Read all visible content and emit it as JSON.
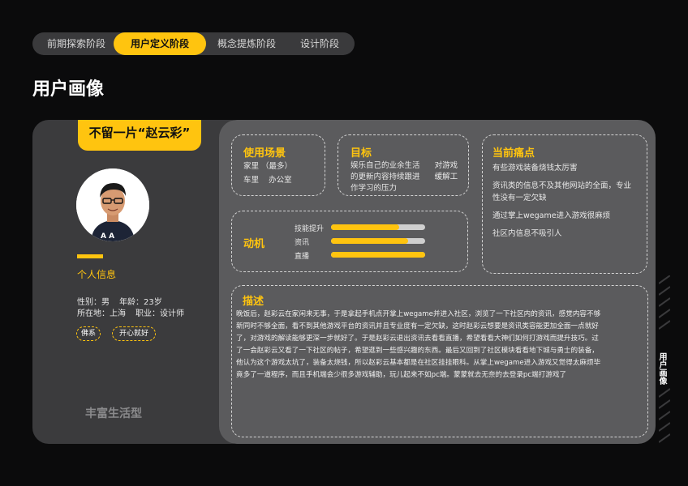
{
  "phases": [
    {
      "label": "前期探索阶段",
      "active": false
    },
    {
      "label": "用户定义阶段",
      "active": true
    },
    {
      "label": "概念提炼阶段",
      "active": false
    },
    {
      "label": "设计阶段",
      "active": false
    }
  ],
  "page_title": "用户画像",
  "persona": {
    "tagline": "不留一片“赵云彩”",
    "section_label": "个人信息",
    "gender_line": "性别：男",
    "age_line": "年龄：23岁",
    "location_line": "所在地：上海",
    "job_line": "职业：设计师",
    "tags": [
      "佛系",
      "开心就好"
    ],
    "lifestyle": "丰富生活型"
  },
  "scenario": {
    "title": "使用场景",
    "lines": [
      "家里 （最多）",
      "车里    办公室"
    ]
  },
  "goal": {
    "title": "目标",
    "lines": [
      "娱乐自己的业余生活      对游戏",
      "的更新内容持续跟进      缓解工",
      "作学习的压力"
    ]
  },
  "pain": {
    "title": "当前痛点",
    "items": [
      "有些游戏装备烧钱太厉害",
      "资讯类的信息不及其他网站的全面，专业性没有一定欠缺",
      "通过掌上wegame进入游戏很麻烦",
      "社区内信息不吸引人"
    ]
  },
  "motivation": {
    "title": "动机",
    "bars": [
      {
        "label": "技能提升",
        "value": 0.72
      },
      {
        "label": "资讯",
        "value": 0.82
      },
      {
        "label": "直播",
        "value": 1.0
      }
    ]
  },
  "description": {
    "title": "描述",
    "lines": [
      "晚饭后，赵彩云在家闲来无事，于是拿起手机点开掌上wegame并进入社区，浏览了一下社区内的资讯，感觉内容不够",
      "新同时不够全面，看不到其他游戏平台的资讯并且专业度有一定欠缺，这时赵彩云想要是资讯类容能更加全面一点就好",
      "了，对游戏的解读能够更深一步就好了。于是赵彩云退出资讯去看看直播，希望看看大神们如何打游戏而提升技巧。过",
      "了一会赵彩云又看了一下社区的帖子，希望逛到一些感兴趣的东西。最后又回到了社区模块看看地下城与勇士的装备，",
      "他认为这个游戏太坑了，装备太烧钱，所以赵彩云基本都是在社区挂挂眼科。从掌上wegame进入游戏又觉得太麻烦毕",
      "竟多了一道程序，而且手机端会少很多游戏辅助，玩儿起来不如pc端。蒙蒙就去无奈的去登录pc端打游戏了"
    ]
  },
  "side_tab": "用户画像",
  "colors": {
    "accent": "#ffc40f",
    "background": "#0b0b0c",
    "left_panel": "#3b3b3d",
    "right_panel": "#5b5b5d"
  }
}
